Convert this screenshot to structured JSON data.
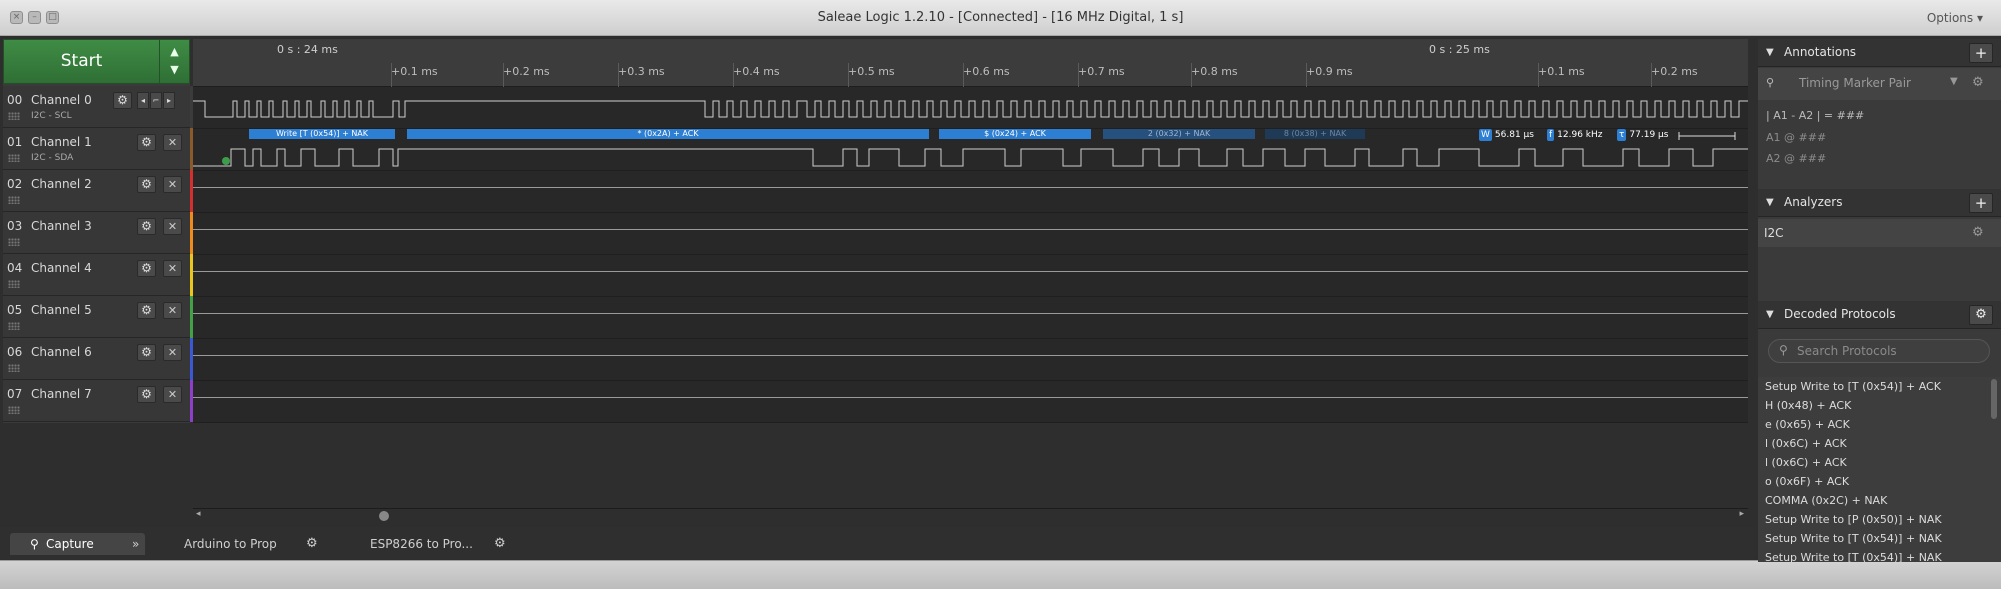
{
  "window": {
    "title": "Saleae Logic 1.2.10 - [Connected] - [16 MHz Digital, 1 s]",
    "options_label": "Options ▾"
  },
  "start": {
    "label": "Start",
    "arrows": "▲▼"
  },
  "channels": [
    {
      "num": "00",
      "name": "Channel 0",
      "sub": "I2C - SCL",
      "color": "#3b3b3b"
    },
    {
      "num": "01",
      "name": "Channel 1",
      "sub": "I2C - SDA",
      "color": "#8b5a2b"
    },
    {
      "num": "02",
      "name": "Channel 2",
      "sub": "",
      "color": "#d32f2f"
    },
    {
      "num": "03",
      "name": "Channel 3",
      "sub": "",
      "color": "#ef8a1f"
    },
    {
      "num": "04",
      "name": "Channel 4",
      "sub": "",
      "color": "#e8c51f"
    },
    {
      "num": "05",
      "name": "Channel 5",
      "sub": "",
      "color": "#43a047"
    },
    {
      "num": "06",
      "name": "Channel 6",
      "sub": "",
      "color": "#3b57d3"
    },
    {
      "num": "07",
      "name": "Channel 7",
      "sub": "",
      "color": "#8e3fc9"
    }
  ],
  "ruler": {
    "main_left": "0 s : 24 ms",
    "main_right": "0 s : 25 ms",
    "ticks": [
      "+0.1 ms",
      "+0.2 ms",
      "+0.3 ms",
      "+0.4 ms",
      "+0.5 ms",
      "+0.6 ms",
      "+0.7 ms",
      "+0.8 ms",
      "+0.9 ms",
      "+0.1 ms",
      "+0.2 ms"
    ]
  },
  "decoded": [
    {
      "text": "Write [T (0x54)] + NAK",
      "color": "#2d7fd4"
    },
    {
      "text": "* (0x2A) + ACK",
      "color": "#2d7fd4"
    },
    {
      "text": "$ (0x24) + ACK",
      "color": "#2d7fd4"
    },
    {
      "text": "2 (0x32) + NAK",
      "color": "#26507e"
    },
    {
      "text": "8 (0x38) + NAK",
      "color": "#1f3a57"
    }
  ],
  "measurements": {
    "width_badge": "W",
    "width": "56.81 µs",
    "freq_badge": "f",
    "freq": "12.96 kHz",
    "period_badge": "τ",
    "period": "77.19 µs"
  },
  "tabs": {
    "capture": "Capture",
    "more": "»",
    "tab1": "Arduino to Prop",
    "tab2": "ESP8266 to Pro..."
  },
  "annotations": {
    "title": "Annotations",
    "item": "Timing Marker Pair",
    "formula": "| A1 - A2 | = ###",
    "a1": "A1  @  ###",
    "a2": "A2  @  ###"
  },
  "analyzers": {
    "title": "Analyzers",
    "items": [
      "I2C"
    ]
  },
  "decoded_protocols": {
    "title": "Decoded Protocols",
    "search_placeholder": "Search Protocols",
    "rows": [
      "Setup Write to [T (0x54)] + ACK",
      "H (0x48) + ACK",
      "e (0x65) + ACK",
      "l (0x6C) + ACK",
      "l (0x6C) + ACK",
      "o (0x6F) + ACK",
      "COMMA (0x2C) + NAK",
      "Setup Write to [P (0x50)] + NAK",
      "Setup Write to [T (0x54)] + NAK",
      "Setup Write to [T (0x54)] + NAK"
    ]
  }
}
